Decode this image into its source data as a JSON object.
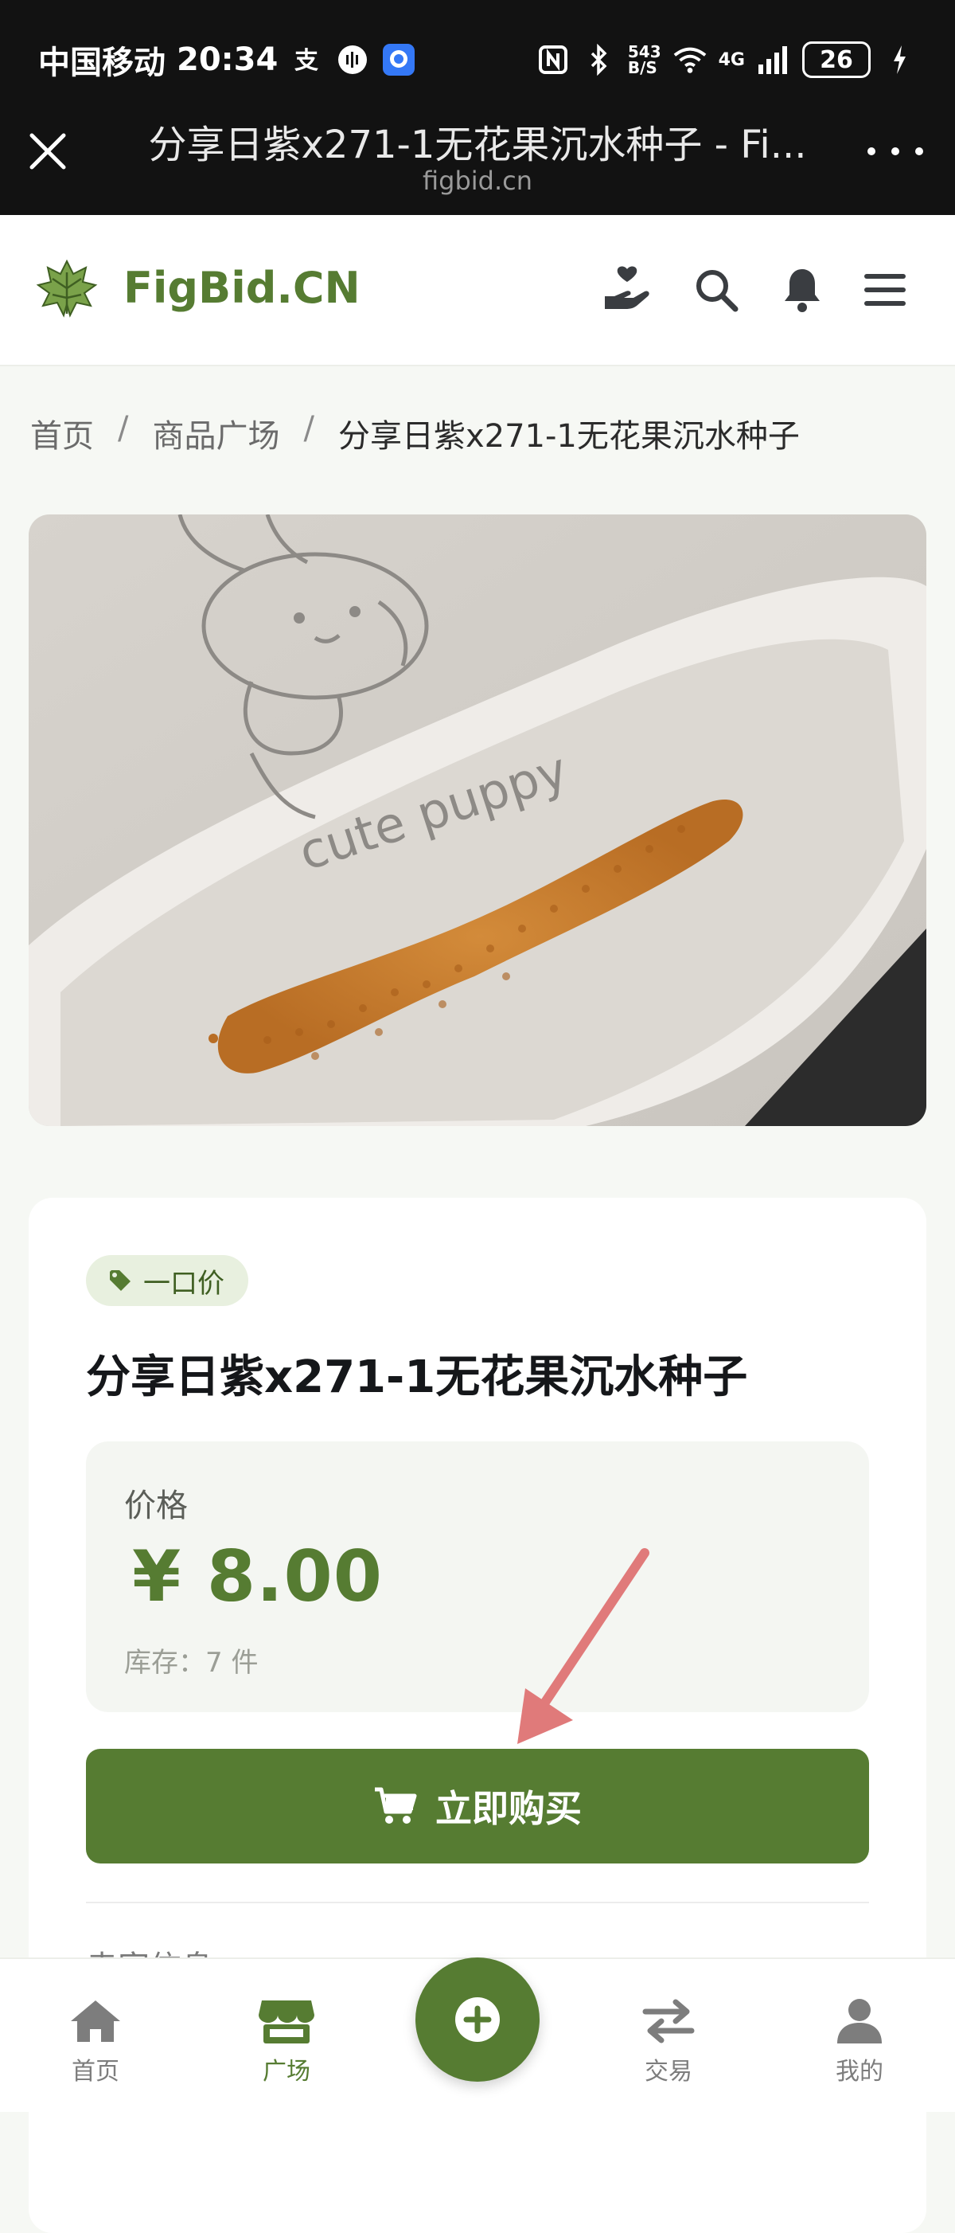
{
  "status_bar": {
    "carrier": "中国移动",
    "time": "20:34",
    "network_speed": "543\nB/S",
    "network_type": "4G",
    "battery": "26"
  },
  "browser": {
    "page_title": "分享日紫x271-1无花果沉水种子 - Fi...",
    "domain": "figbid.cn"
  },
  "header": {
    "brand": "FigBid.CN",
    "icons": [
      "charity-hand-icon",
      "search-icon",
      "bell-icon",
      "menu-icon"
    ]
  },
  "breadcrumb": {
    "items": [
      "首页",
      "商品广场",
      "分享日紫x271-1无花果沉水种子"
    ],
    "separator": "/"
  },
  "product": {
    "photo_caption": "cute puppy",
    "badge": "一口价",
    "title": "分享日紫x271-1无花果沉水种子",
    "price_label": "价格",
    "price": "¥ 8.00",
    "stock": "库存：7 件",
    "buy_label": "立即购买",
    "seller_section_label": "卖家信息"
  },
  "bottom_nav": {
    "items": [
      {
        "label": "首页",
        "icon": "home-icon"
      },
      {
        "label": "广场",
        "icon": "store-icon"
      },
      {
        "label": "交易",
        "icon": "swap-icon"
      },
      {
        "label": "我的",
        "icon": "user-icon"
      }
    ],
    "fab_icon": "plus-icon"
  },
  "colors": {
    "accent": "#567c32",
    "accent_light": "#e8f0df",
    "annotation_arrow": "#e07a7a"
  }
}
